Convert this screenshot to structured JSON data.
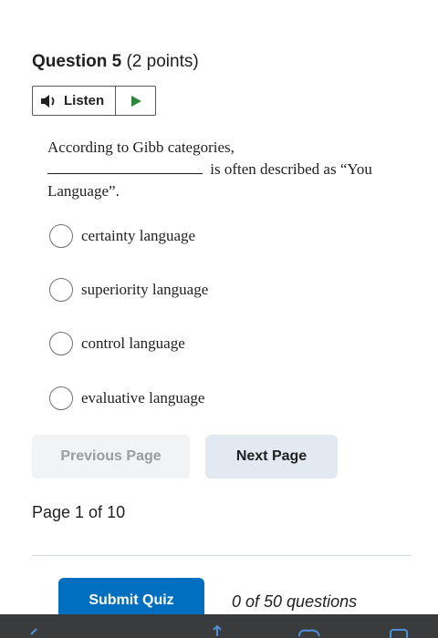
{
  "question": {
    "number_label": "Question 5",
    "points": "(2 points)",
    "text_before_blank": "According to Gibb categories,",
    "text_after_blank": "is often described as “You Language”."
  },
  "listen": {
    "label": "Listen",
    "speaker_icon": "speaker-icon",
    "play_icon": "play-icon",
    "play_color": "#2e8540"
  },
  "options": [
    {
      "label": "certainty language"
    },
    {
      "label": "superiority language"
    },
    {
      "label": "control language"
    },
    {
      "label": "evaluative language"
    }
  ],
  "navigation": {
    "previous_label": "Previous Page",
    "next_label": "Next Page",
    "page_indicator": "Page 1 of 10"
  },
  "footer": {
    "submit_label": "Submit Quiz",
    "question_count": "0 of 50 questions",
    "accent": "#006fbf"
  }
}
